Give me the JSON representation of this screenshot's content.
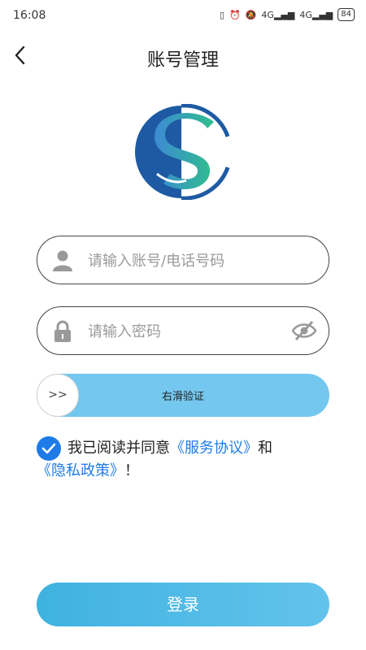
{
  "status_bar": {
    "time": "16:08",
    "signal1": "4G",
    "signal2": "4G",
    "battery": "84"
  },
  "nav": {
    "title": "账号管理",
    "back_icon": "back-arrow-icon"
  },
  "account_field": {
    "placeholder": "请输入账号/电话号码",
    "icon": "user-icon"
  },
  "password_field": {
    "placeholder": "请输入密码",
    "icon": "lock-icon",
    "toggle_icon": "eye-off-icon"
  },
  "slider": {
    "knob_label": ">>",
    "label": "右滑验证"
  },
  "agreement": {
    "prefix": "我已阅读并同意",
    "service_link": "《服务协议》",
    "and": "和",
    "privacy_link": "《隐私政策》",
    "suffix": "！",
    "checked": true
  },
  "login_button": {
    "label": "登录"
  },
  "colors": {
    "accent": "#1e7be8",
    "slider": "#74c8ef",
    "login": "#4bb9e6"
  }
}
